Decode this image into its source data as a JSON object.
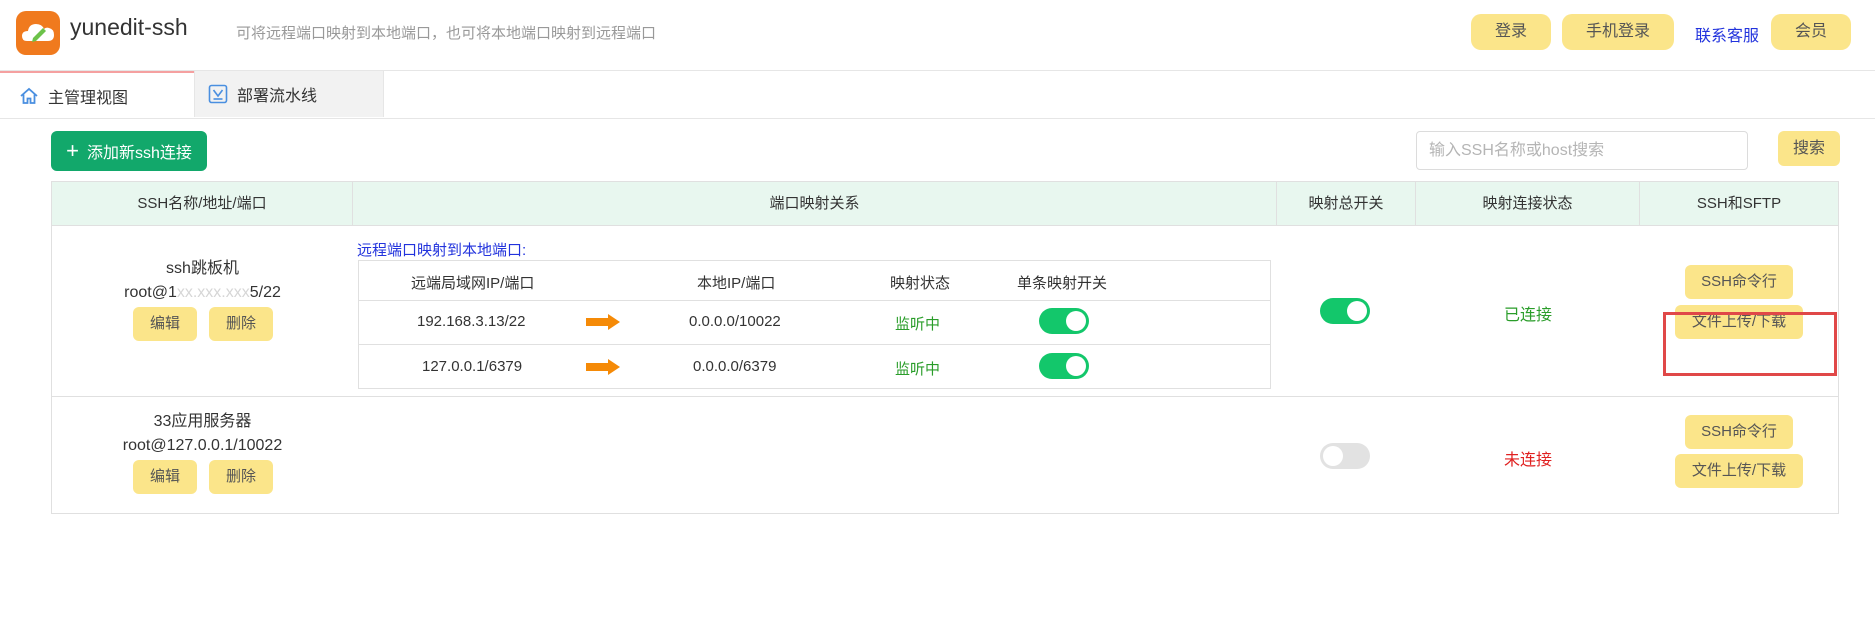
{
  "header": {
    "app_title": "yunedit-ssh",
    "description": "可将远程端口映射到本地端口，也可将本地端口映射到远程端口",
    "login_label": "登录",
    "phone_login_label": "手机登录",
    "contact_label": "联系客服",
    "member_label": "会员"
  },
  "tabs": [
    {
      "label": "主管理视图",
      "icon": "home-icon"
    },
    {
      "label": "部署流水线",
      "icon": "pipeline-icon"
    }
  ],
  "toolbar": {
    "add_label": "添加新ssh连接",
    "search_placeholder": "输入SSH名称或host搜索",
    "search_label": "搜索"
  },
  "table": {
    "columns": [
      "SSH名称/地址/端口",
      "端口映射关系",
      "映射总开关",
      "映射连接状态",
      "SSH和SFTP"
    ],
    "rows": [
      {
        "name": "ssh跳板机",
        "address_prefix": "root@1",
        "address_masked": "xx.xxx.xxx",
        "address_suffix": "5/22",
        "edit_label": "编辑",
        "delete_label": "删除",
        "mapping_title": "远程端口映射到本地端口:",
        "mapping_headers": [
          "远端局域网IP/端口",
          "本地IP/端口",
          "映射状态",
          "单条映射开关"
        ],
        "mappings": [
          {
            "remote": "192.168.3.13/22",
            "local": "0.0.0.0/10022",
            "status": "监听中",
            "enabled": true
          },
          {
            "remote": "127.0.0.1/6379",
            "local": "0.0.0.0/6379",
            "status": "监听中",
            "enabled": true
          }
        ],
        "master_switch": true,
        "connection_status": "已连接",
        "ssh_label": "SSH命令行",
        "sftp_label": "文件上传/下载"
      },
      {
        "name": "33应用服务器",
        "address": "root@127.0.0.1/10022",
        "edit_label": "编辑",
        "delete_label": "删除",
        "master_switch": false,
        "connection_status": "未连接",
        "ssh_label": "SSH命令行",
        "sftp_label": "文件上传/下载"
      }
    ]
  },
  "colors": {
    "accent_yellow": "#fbe58a",
    "primary_green": "#12a86b",
    "toggle_on": "#13c76b",
    "status_connected": "#2a9d2a",
    "status_disconnected": "#e02020",
    "highlight_red": "#e04848"
  }
}
